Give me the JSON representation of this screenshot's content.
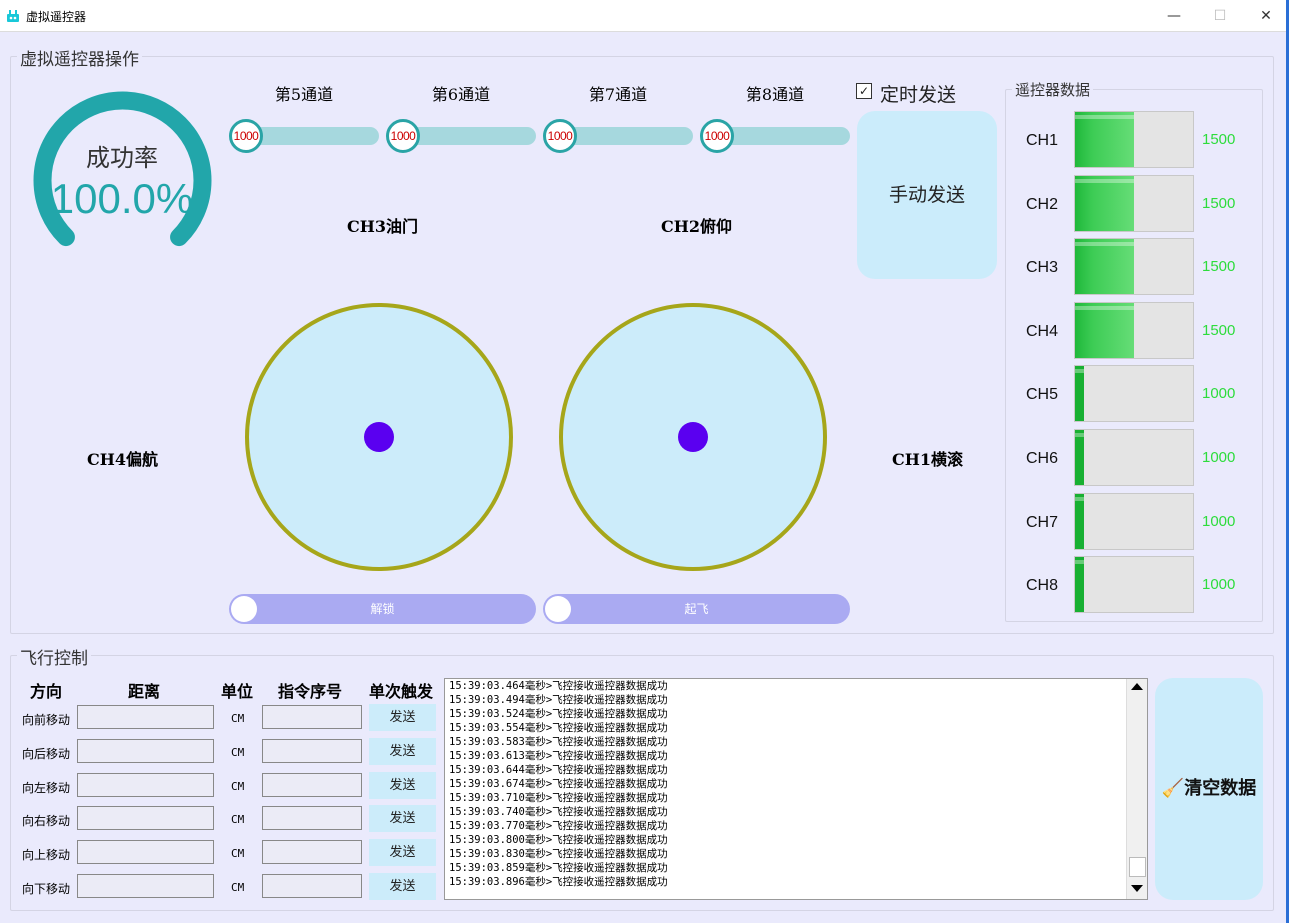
{
  "window": {
    "title": "虚拟遥控器",
    "min": "—",
    "max": "☐",
    "close": "✕"
  },
  "ops_group": {
    "title": "虚拟遥控器操作"
  },
  "gauge": {
    "label": "成功率",
    "value_text": "100.0%",
    "value": 100.0
  },
  "aux_channels": [
    {
      "label": "第5通道",
      "value": "1000"
    },
    {
      "label": "第6通道",
      "value": "1000"
    },
    {
      "label": "第7通道",
      "value": "1000"
    },
    {
      "label": "第8通道",
      "value": "1000"
    }
  ],
  "timed_send": {
    "label": "定时发送",
    "checked": true,
    "mark": "✓"
  },
  "manual_send": {
    "label": "手动发送"
  },
  "axes": {
    "throttle": "CH3油门",
    "pitch": "CH2俯仰",
    "yaw": "CH4偏航",
    "roll": "CH1横滚"
  },
  "toggles": {
    "unlock": "解锁",
    "takeoff": "起飞"
  },
  "rc_group": {
    "title": "遥控器数据"
  },
  "rc_channels": [
    {
      "name": "CH1",
      "value": "1500",
      "fill": 0.5
    },
    {
      "name": "CH2",
      "value": "1500",
      "fill": 0.5
    },
    {
      "name": "CH3",
      "value": "1500",
      "fill": 0.5
    },
    {
      "name": "CH4",
      "value": "1500",
      "fill": 0.5
    },
    {
      "name": "CH5",
      "value": "1000",
      "fill": 0.0
    },
    {
      "name": "CH6",
      "value": "1000",
      "fill": 0.0
    },
    {
      "name": "CH7",
      "value": "1000",
      "fill": 0.0
    },
    {
      "name": "CH8",
      "value": "1000",
      "fill": 0.0
    }
  ],
  "flight_group": {
    "title": "飞行控制"
  },
  "flight_headers": {
    "direction": "方向",
    "distance": "距离",
    "unit": "单位",
    "seq": "指令序号",
    "single": "单次触发"
  },
  "flight_rows": [
    {
      "dir": "向前移动",
      "unit": "CM",
      "send": "发送"
    },
    {
      "dir": "向后移动",
      "unit": "CM",
      "send": "发送"
    },
    {
      "dir": "向左移动",
      "unit": "CM",
      "send": "发送"
    },
    {
      "dir": "向右移动",
      "unit": "CM",
      "send": "发送"
    },
    {
      "dir": "向上移动",
      "unit": "CM",
      "send": "发送"
    },
    {
      "dir": "向下移动",
      "unit": "CM",
      "send": "发送"
    }
  ],
  "log": [
    "15:39:03.464毫秒>飞控接收遥控器数据成功",
    "15:39:03.494毫秒>飞控接收遥控器数据成功",
    "15:39:03.524毫秒>飞控接收遥控器数据成功",
    "15:39:03.554毫秒>飞控接收遥控器数据成功",
    "15:39:03.583毫秒>飞控接收遥控器数据成功",
    "15:39:03.613毫秒>飞控接收遥控器数据成功",
    "15:39:03.644毫秒>飞控接收遥控器数据成功",
    "15:39:03.674毫秒>飞控接收遥控器数据成功",
    "15:39:03.710毫秒>飞控接收遥控器数据成功",
    "15:39:03.740毫秒>飞控接收遥控器数据成功",
    "15:39:03.770毫秒>飞控接收遥控器数据成功",
    "15:39:03.800毫秒>飞控接收遥控器数据成功",
    "15:39:03.830毫秒>飞控接收遥控器数据成功",
    "15:39:03.859毫秒>飞控接收遥控器数据成功",
    "15:39:03.896毫秒>飞控接收遥控器数据成功"
  ],
  "clear_button": {
    "label": "清空数据"
  },
  "colors": {
    "gauge": "#22a6aa",
    "joystick_ring": "#a6a61a",
    "joystick_dot": "#5a00f0",
    "rc_value": "#2ddc3c"
  }
}
